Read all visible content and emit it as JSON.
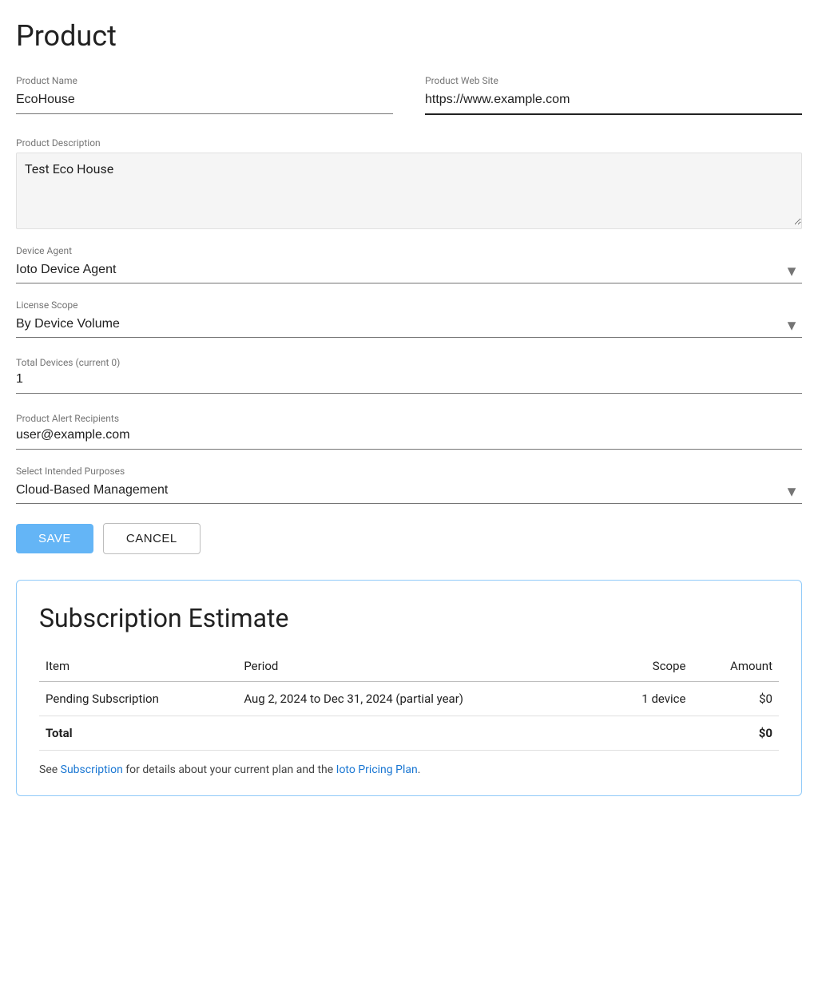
{
  "page": {
    "title": "Product"
  },
  "form": {
    "product_name_label": "Product Name",
    "product_name_value": "EcoHouse",
    "product_website_label": "Product Web Site",
    "product_website_value": "https://www.example.com",
    "product_description_label": "Product Description",
    "product_description_value": "Test Eco House",
    "device_agent_label": "Device Agent",
    "device_agent_value": "Ioto Device Agent",
    "device_agent_options": [
      "Ioto Device Agent"
    ],
    "license_scope_label": "License Scope",
    "license_scope_value": "By Device Volume",
    "license_scope_options": [
      "By Device Volume"
    ],
    "total_devices_label": "Total Devices (current 0)",
    "total_devices_value": "1",
    "product_alert_recipients_label": "Product Alert Recipients",
    "product_alert_recipients_value": "user@example.com",
    "select_intended_purposes_label": "Select Intended Purposes",
    "select_intended_purposes_value": "Cloud-Based Management",
    "select_intended_purposes_options": [
      "Cloud-Based Management"
    ],
    "save_button_label": "SAVE",
    "cancel_button_label": "CANCEL"
  },
  "subscription": {
    "title": "Subscription Estimate",
    "table": {
      "headers": [
        "Item",
        "Period",
        "Scope",
        "Amount"
      ],
      "rows": [
        {
          "item": "Pending Subscription",
          "period": "Aug 2, 2024 to Dec 31, 2024 (partial year)",
          "scope": "1 device",
          "amount": "$0"
        }
      ],
      "total_label": "Total",
      "total_amount": "$0"
    },
    "footer_text_before_link1": "See ",
    "footer_link1_label": "Subscription",
    "footer_text_between": " for details about your current plan and the ",
    "footer_link2_label": "Ioto Pricing Plan",
    "footer_text_after": "."
  }
}
